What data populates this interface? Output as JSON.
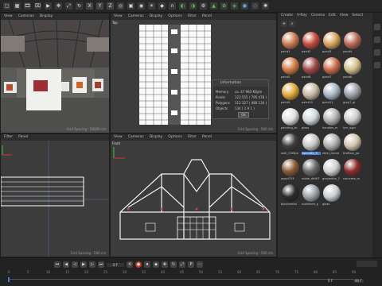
{
  "toolbar": {
    "icons": [
      "square-icon",
      "grid-icon",
      "film-icon",
      "clapper-icon",
      "play-icon",
      "move-icon",
      "scale-icon",
      "rotate-icon",
      "x-axis",
      "y-axis",
      "z-axis",
      "world-icon",
      "camera-icon",
      "target-icon",
      "light-icon",
      "cube-icon",
      "magnet-icon",
      "render-icon",
      "render-view-icon",
      "render-settings-icon",
      "prism-icon",
      "grass-icon",
      "teardrop-icon",
      "sphere-icon",
      "gem-icon",
      "light-bulb-icon"
    ],
    "xyz": [
      "X",
      "Y",
      "Z"
    ]
  },
  "viewport_top": {
    "menu": [
      "View",
      "Cameras",
      "Display",
      "Options",
      "Filter",
      "Panel"
    ],
    "label": "Top",
    "grid": "Grid Spacing : 500 cm"
  },
  "viewport_persp": {
    "menu": [
      "View",
      "Cameras",
      "Display",
      "Options",
      "Filter",
      "Panel"
    ],
    "grid": "Grid Spacing : 50000 cm"
  },
  "viewport_right": {
    "menu": [
      "Filter",
      "Panel"
    ],
    "grid": "Grid Spacing : 500 cm"
  },
  "viewport_front": {
    "menu": [
      "View",
      "Cameras",
      "Display",
      "Options",
      "Filter",
      "Panel"
    ],
    "label": "Front",
    "grid": "Grid Spacing : 500 cm"
  },
  "info_dialog": {
    "title": "Information",
    "rows": [
      {
        "k": "Memory",
        "v": "ca. 47 983 KByte"
      },
      {
        "k": "Points",
        "v": "123 555 ( 795 478 )"
      },
      {
        "k": "Polygons",
        "v": "112 327 ( 480 134 )"
      },
      {
        "k": "Objects",
        "v": "134 ( 1 9 1 )"
      }
    ],
    "ok": "OK"
  },
  "material_panel": {
    "menu": [
      "Create",
      "V-Ray",
      "Cinema",
      "Edit",
      "View",
      "Select"
    ],
    "materials": [
      {
        "n": "paint1",
        "c": "#c97a50"
      },
      {
        "n": "paint2",
        "c": "#c44a3e"
      },
      {
        "n": "paint3",
        "c": "#d6a25c"
      },
      {
        "n": "paint4",
        "c": "#b86a55"
      },
      {
        "n": "paint5",
        "c": "#d27b45"
      },
      {
        "n": "paint6",
        "c": "#9e4a48"
      },
      {
        "n": "paint7",
        "c": "#c86c4a"
      },
      {
        "n": "paint8",
        "c": "#d2bf8a"
      },
      {
        "n": "paint9",
        "c": "#e0a83a"
      },
      {
        "n": "paint10",
        "c": "#c7b8a2"
      },
      {
        "n": "paint11",
        "c": "#a7b6c6"
      },
      {
        "n": "grey7_gl",
        "c": "#9aa0a8"
      },
      {
        "n": "painting_bc",
        "c": "#e0e0e0"
      },
      {
        "n": "glass",
        "c": "#cfd8dc"
      },
      {
        "n": "handles_m",
        "c": "#b2b2b2"
      },
      {
        "n": "lyrc_sign",
        "c": "#cbcbcb"
      },
      {
        "n": "wall_COMpo",
        "c": "#3e3e3e"
      },
      {
        "n": "concrete_fr",
        "c": "#c8c8c8"
      },
      {
        "n": "steel_frame",
        "c": "#b0b0b0"
      },
      {
        "n": "tirefloor_pa",
        "c": "#d2c4b0"
      },
      {
        "n": "wood753",
        "c": "#8a5a34"
      },
      {
        "n": "noble_dirt97",
        "c": "#6b6b6b"
      },
      {
        "n": "greywhite_7",
        "c": "#d0d0d0"
      },
      {
        "n": "concrete_m",
        "c": "#8c2a2a"
      },
      {
        "n": "blackmetal",
        "c": "#2a2a2a"
      },
      {
        "n": "roofsheet_p",
        "c": "#9da3a8"
      },
      {
        "n": "glass",
        "c": "#c8ced2"
      }
    ],
    "selected": "concrete_fr"
  },
  "timeline": {
    "ticks": [
      "0",
      "5",
      "10",
      "15",
      "20",
      "25",
      "30",
      "35",
      "40",
      "45",
      "50",
      "55",
      "60",
      "65",
      "70",
      "75",
      "80",
      "85",
      "90"
    ],
    "start": "0 F",
    "end": "90 F",
    "current": "0 F"
  },
  "colors": {
    "accent": "#3b7fd6"
  }
}
